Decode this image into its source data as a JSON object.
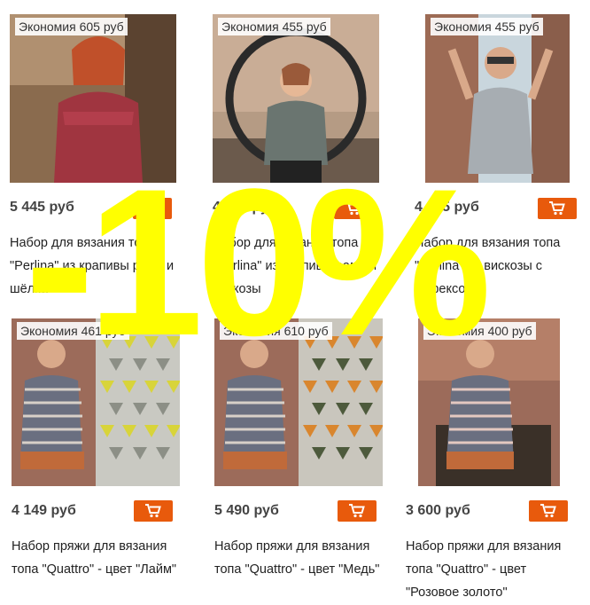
{
  "promo": {
    "text": "-10%"
  },
  "products": [
    {
      "badge": "Экономия 605 руб",
      "price": "5 445 руб",
      "title": "Набор для вязания топа \"Perlina\" из крапивы рами и шёлка"
    },
    {
      "badge": "Экономия 455 руб",
      "price": "4 095 руб",
      "title": "Набор для вязания топа \"Perlina\" из крапивы рами и вискозы"
    },
    {
      "badge": "Экономия 455 руб",
      "price": "4 095 руб",
      "title": "Набор для вязания топа \"Perlina\" из вискозы с люрексом"
    },
    {
      "badge": "Экономия 461 руб",
      "price": "4 149 руб",
      "title": "Набор пряжи для вязания топа \"Quattro\" - цвет \"Лайм\""
    },
    {
      "badge": "Экономия 610 руб",
      "price": "5 490 руб",
      "title": "Набор пряжи для вязания топа \"Quattro\" - цвет \"Медь\""
    },
    {
      "badge": "Экономия 400 руб",
      "price": "3 600 руб",
      "title": "Набор пряжи для вязания топа \"Quattro\" - цвет \"Розовое золото\""
    }
  ],
  "icons": {
    "cart": "shopping-cart-icon"
  },
  "colors": {
    "accent": "#e85a0c",
    "promo": "#ffff00"
  }
}
